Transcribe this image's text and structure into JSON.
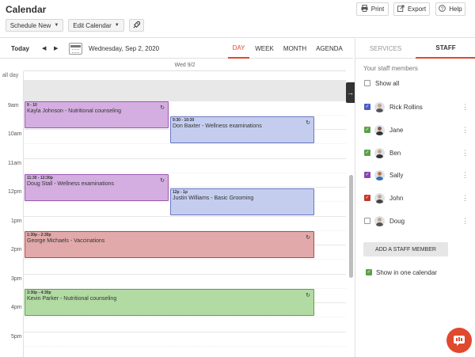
{
  "app": {
    "title": "Calendar"
  },
  "toolbar": {
    "schedule_new": "Schedule New",
    "edit_calendar": "Edit Calendar",
    "print": "Print",
    "export": "Export",
    "help": "Help"
  },
  "calendar_toolbar": {
    "today": "Today",
    "current_date": "Wednesday, Sep 2, 2020",
    "views": [
      "DAY",
      "WEEK",
      "MONTH",
      "AGENDA"
    ],
    "active_view": "DAY"
  },
  "day_header": "Wed 9/2",
  "allday_label": "all day",
  "hours": [
    "9am",
    "10am",
    "11am",
    "12pm",
    "1pm",
    "2pm",
    "3pm",
    "4pm",
    "5pm"
  ],
  "events": [
    {
      "time": "9 - 10",
      "title": "Kayla Johnson - Nutritional counseling",
      "color": "#d4aee0",
      "border": "#9b5ab0"
    },
    {
      "time": "9:30 - 10:30",
      "title": "Don Baxter - Wellness examinations",
      "color": "#c5cdef",
      "border": "#6977c4"
    },
    {
      "time": "11:30 - 12:30p",
      "title": "Doug Stall - Wellness examinations",
      "color": "#d4aee0",
      "border": "#9b5ab0"
    },
    {
      "time": "12p - 1p",
      "title": "Justin Williams - Basic Grooming",
      "color": "#c5cdef",
      "border": "#6977c4"
    },
    {
      "time": "1:30p - 2:30p",
      "title": "George Michaels - Vaccinations",
      "color": "#e1a9a9",
      "border": "#b34a4a"
    },
    {
      "time": "3:30p - 4:30p",
      "title": "Kevin Parker - Nutritional counseling",
      "color": "#b2dba3",
      "border": "#5ca048"
    }
  ],
  "right_panel": {
    "tabs": [
      "SERVICES",
      "STAFF"
    ],
    "active_tab": "STAFF",
    "heading": "Your staff members",
    "show_all": "Show all",
    "staff": [
      {
        "name": "Rick Rollins",
        "color": "#4a5ec4",
        "checked": true
      },
      {
        "name": "Jane",
        "color": "#5ca048",
        "checked": true
      },
      {
        "name": "Ben",
        "color": "#5ca048",
        "checked": true
      },
      {
        "name": "Sally",
        "color": "#8e44ad",
        "checked": true
      },
      {
        "name": "John",
        "color": "#c0392b",
        "checked": true
      },
      {
        "name": "Doug",
        "color": "#ffffff",
        "checked": false
      }
    ],
    "add_staff": "ADD A STAFF MEMBER",
    "show_in_one_calendar": "Show in one calendar",
    "show_in_one_color": "#5ca048"
  },
  "icons": {
    "print": "printer-icon",
    "export": "export-icon",
    "help": "help-icon",
    "rocket": "rocket-icon",
    "calendar": "calendar-icon",
    "repeat": "repeat-icon",
    "collapse": "arrow-right-icon",
    "chat": "chat-icon"
  },
  "colors": {
    "accent": "#e0492e"
  }
}
